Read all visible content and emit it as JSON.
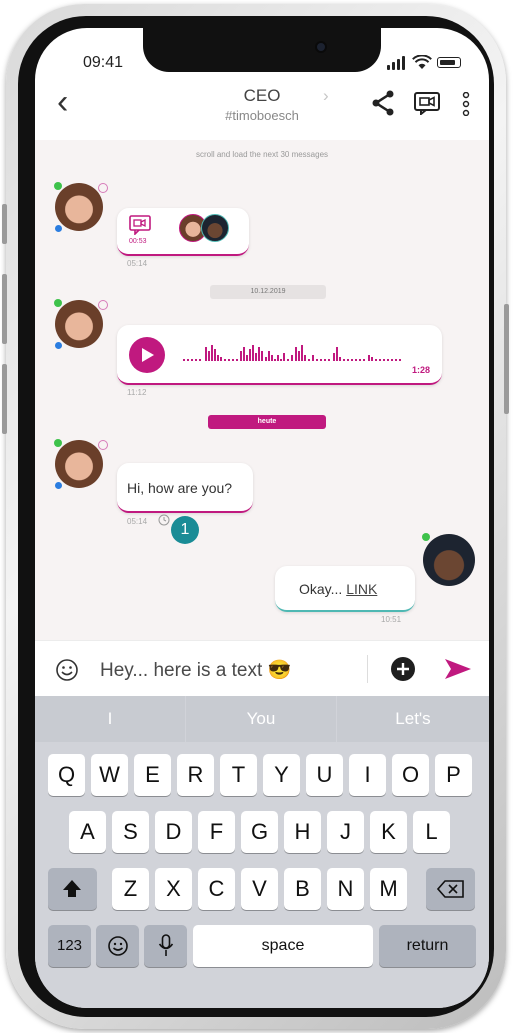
{
  "status": {
    "time": "09:41"
  },
  "header": {
    "title": "CEO",
    "subtitle": "#timoboesch"
  },
  "chat": {
    "load_more": "scroll and load the next 30 messages",
    "video_message": {
      "duration": "00:53",
      "time": "05:14"
    },
    "date_1": "10.12.2019",
    "voice_message": {
      "duration": "1:28",
      "time": "11:12"
    },
    "date_today": "heute",
    "text_message_in": {
      "text": "Hi, how are you?",
      "time": "05:14"
    },
    "badge_count": "1",
    "text_message_out": {
      "text": "Okay...",
      "link": "LINK",
      "time": "10:51"
    }
  },
  "composer": {
    "text": "Hey... here is a text 😎"
  },
  "keyboard": {
    "suggestions": [
      "I",
      "You",
      "Let's"
    ],
    "row1": [
      "Q",
      "W",
      "E",
      "R",
      "T",
      "Y",
      "U",
      "I",
      "O",
      "P"
    ],
    "row2": [
      "A",
      "S",
      "D",
      "F",
      "G",
      "H",
      "J",
      "K",
      "L"
    ],
    "row3": [
      "Z",
      "X",
      "C",
      "V",
      "B",
      "N",
      "M"
    ],
    "numbers_key": "123",
    "space_key": "space",
    "return_key": "return"
  },
  "colors": {
    "accent": "#c0197f",
    "outgoing": "#4fb8b3",
    "badge": "#1a8c96",
    "online": "#3ec24b"
  }
}
